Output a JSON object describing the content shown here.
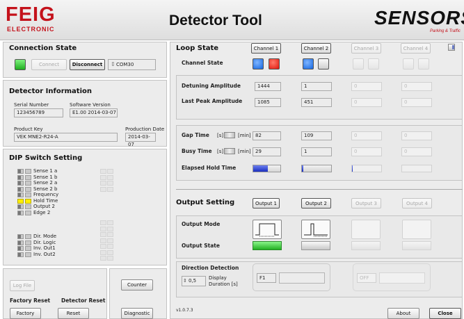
{
  "header": {
    "logo_left": "FEIG",
    "logo_left_sub": "ELECTRONIC",
    "title": "Detector Tool",
    "logo_right": "SENSORS",
    "logo_right_sub": "Parking & Traffic"
  },
  "connection": {
    "title": "Connection State",
    "status_color": "#2ecc2e",
    "connect_label": "Connect",
    "disconnect_label": "Disconnect",
    "port": "COM30"
  },
  "detector_info": {
    "title": "Detector Information",
    "serial_label": "Serial Number",
    "serial_value": "123456789",
    "software_label": "Software Version",
    "software_value": "E1.00 2014-03-07",
    "product_key_label": "Product Key",
    "product_key_value": "VEK MNE2-R24-A",
    "production_date_label": "Production Date",
    "production_date_value": "2014-03-07"
  },
  "dip": {
    "title": "DIP Switch Setting",
    "group1": [
      "Sense 1 a",
      "Sense 1 b",
      "Sense 2 a",
      "Sense 2 b",
      "Frequency",
      "Hold Time",
      "Output 2",
      "Edge 2"
    ],
    "group2": [
      "Dir. Mode",
      "Dir. Logic",
      "Inv. Out1",
      "Inv. Out2"
    ]
  },
  "bottom_left": {
    "log_file": "Log File",
    "factory_reset_title": "Factory Reset",
    "detector_reset_title": "Detector Reset",
    "factory_btn": "Factory",
    "reset_btn": "Reset",
    "counter_btn": "Counter",
    "diagnostic_btn": "Diagnostic"
  },
  "loop": {
    "title": "Loop State",
    "channels": [
      "Channel 1",
      "Channel 2",
      "Channel 3",
      "Channel 4"
    ],
    "channel_state_label": "Channel State",
    "detuning_label": "Detuning Amplitude",
    "detuning": [
      "1444",
      "1",
      "0",
      "0"
    ],
    "last_peak_label": "Last Peak Amplitude",
    "last_peak": [
      "1085",
      "451",
      "0",
      "0"
    ],
    "gap_label": "Gap Time",
    "busy_label": "Busy Time",
    "unit_s": "[s]",
    "unit_min": "[min]",
    "gap": [
      "82",
      "109",
      "0",
      "0"
    ],
    "busy": [
      "29",
      "1",
      "0",
      "0"
    ],
    "elapsed_label": "Elapsed Hold Time",
    "elapsed_fraction": [
      0.55,
      0.04,
      0.02,
      0.0
    ]
  },
  "output": {
    "title": "Output Setting",
    "outputs": [
      "Output 1",
      "Output 2",
      "Output 3",
      "Output 4"
    ],
    "mode_label": "Output Mode",
    "state_label": "Output State"
  },
  "direction": {
    "title": "Direction Detection",
    "duration_value": "0,5",
    "duration_label_1": "Display",
    "duration_label_2": "Duration [s]",
    "f1_value": "F1",
    "off_value": "OFF"
  },
  "footer": {
    "version": "v1.0.7.3",
    "about": "About",
    "close": "Close"
  }
}
